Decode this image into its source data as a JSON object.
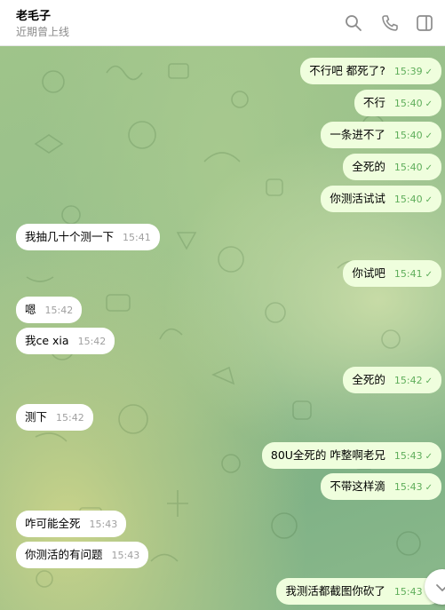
{
  "header": {
    "title": "老毛子",
    "status": "近期曾上线"
  },
  "icons": {
    "search": "search-icon",
    "call": "phone-icon",
    "sidebar": "sidebar-toggle-icon",
    "scroll": "chevron-down-icon"
  },
  "colors": {
    "outgoing_bubble": "#effedd",
    "incoming_bubble": "#ffffff",
    "outgoing_time": "#5fae5b",
    "incoming_time": "#a0a0a0"
  },
  "messages": [
    {
      "side": "out",
      "text": "不行吧 都死了?",
      "time": "15:39"
    },
    {
      "side": "out",
      "text": "不行",
      "time": "15:40"
    },
    {
      "side": "out",
      "text": "一条进不了",
      "time": "15:40"
    },
    {
      "side": "out",
      "text": "全死的",
      "time": "15:40"
    },
    {
      "side": "out",
      "text": "你测活试试",
      "time": "15:40"
    },
    {
      "side": "in",
      "text": "我抽几十个测一下",
      "time": "15:41"
    },
    {
      "side": "out",
      "text": "你试吧",
      "time": "15:41"
    },
    {
      "side": "in",
      "text": "嗯",
      "time": "15:42"
    },
    {
      "side": "in",
      "text": "我ce xia",
      "time": "15:42"
    },
    {
      "side": "out",
      "text": "全死的",
      "time": "15:42"
    },
    {
      "side": "in",
      "text": "测下",
      "time": "15:42"
    },
    {
      "side": "out",
      "text": "80U全死的 咋整啊老兄",
      "time": "15:43"
    },
    {
      "side": "out",
      "text": "不带这样滴",
      "time": "15:43"
    },
    {
      "side": "in",
      "text": "咋可能全死",
      "time": "15:43"
    },
    {
      "side": "in",
      "text": "你测活的有问题",
      "time": "15:43"
    },
    {
      "side": "out",
      "text": "我测活都截图你砍了",
      "time": "15:43"
    }
  ]
}
